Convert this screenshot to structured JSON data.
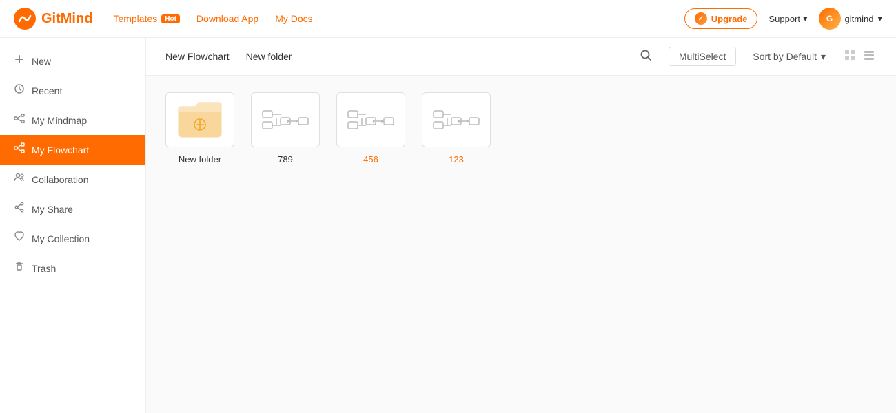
{
  "header": {
    "logo_text": "GitMind",
    "nav": [
      {
        "label": "Templates",
        "badge": "Hot",
        "key": "templates"
      },
      {
        "label": "Download App",
        "badge": null,
        "key": "download-app"
      },
      {
        "label": "My Docs",
        "badge": null,
        "key": "my-docs"
      }
    ],
    "upgrade_label": "Upgrade",
    "support_label": "Support",
    "user_label": "gitmind"
  },
  "sidebar": {
    "items": [
      {
        "key": "new",
        "label": "New",
        "icon": "plus-icon"
      },
      {
        "key": "recent",
        "label": "Recent",
        "icon": "clock-icon"
      },
      {
        "key": "my-mindmap",
        "label": "My Mindmap",
        "icon": "mindmap-icon"
      },
      {
        "key": "my-flowchart",
        "label": "My Flowchart",
        "icon": "flowchart-icon",
        "active": true
      },
      {
        "key": "collaboration",
        "label": "Collaboration",
        "icon": "people-icon"
      },
      {
        "key": "my-share",
        "label": "My Share",
        "icon": "share-icon"
      },
      {
        "key": "my-collection",
        "label": "My Collection",
        "icon": "heart-icon"
      },
      {
        "key": "trash",
        "label": "Trash",
        "icon": "trash-icon"
      }
    ]
  },
  "toolbar": {
    "new_flowchart_label": "New Flowchart",
    "new_folder_label": "New folder",
    "multiselect_label": "MultiSelect",
    "sort_label": "Sort by Default",
    "view_grid_label": "grid-view",
    "view_list_label": "list-view"
  },
  "content": {
    "files": [
      {
        "name": "New folder",
        "type": "folder",
        "name_color": "normal"
      },
      {
        "name": "789",
        "type": "flowchart",
        "name_color": "normal"
      },
      {
        "name": "456",
        "type": "flowchart",
        "name_color": "orange"
      },
      {
        "name": "123",
        "type": "flowchart",
        "name_color": "orange"
      }
    ]
  }
}
